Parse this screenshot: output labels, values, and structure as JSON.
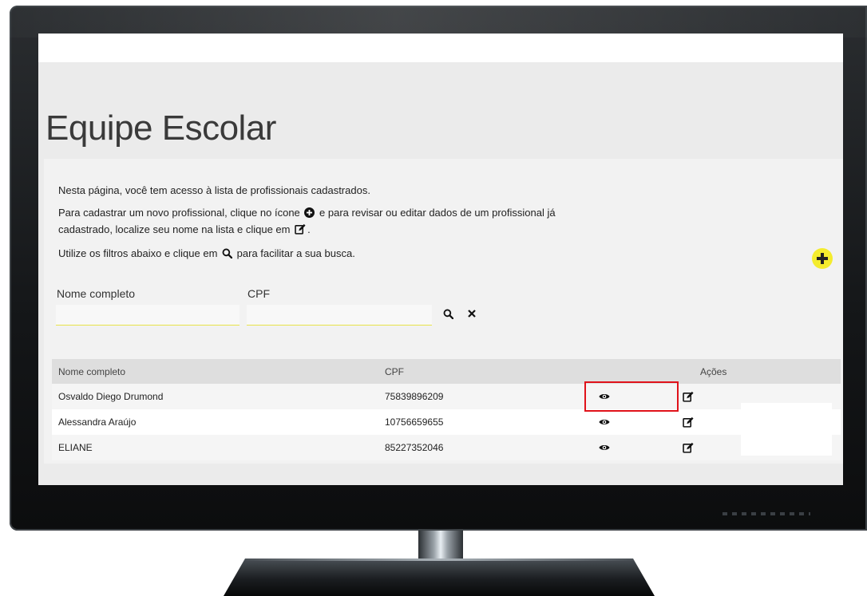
{
  "page": {
    "title": "Equipe Escolar",
    "intro": {
      "line1": "Nesta página, você tem acesso à lista de profissionais cadastrados.",
      "line2_before": "Para cadastrar um novo profissional, clique no ícone",
      "line2_after": "e para revisar ou editar dados de um profissional já cadastrado, localize seu nome na lista e clique em",
      "line2_end": ".",
      "line3_before": "Utilize os filtros abaixo e clique em",
      "line3_after": "para facilitar a sua busca."
    }
  },
  "filters": {
    "name_label": "Nome completo",
    "name_value": "",
    "cpf_label": "CPF",
    "cpf_value": ""
  },
  "table": {
    "headers": {
      "name": "Nome completo",
      "cpf": "CPF",
      "actions": "Ações"
    },
    "rows": [
      {
        "name": "Osvaldo Diego Drumond",
        "cpf": "75839896209"
      },
      {
        "name": "Alessandra Araújo",
        "cpf": "10756659655"
      },
      {
        "name": "ELIANE",
        "cpf": "85227352046"
      }
    ]
  },
  "icons": {
    "add": "plus-circle-icon",
    "search": "search-icon",
    "clear": "close-icon",
    "view": "eye-icon",
    "edit": "edit-icon"
  },
  "colors": {
    "accent_yellow": "#f4ec2e",
    "highlight_red": "#e0121a"
  }
}
